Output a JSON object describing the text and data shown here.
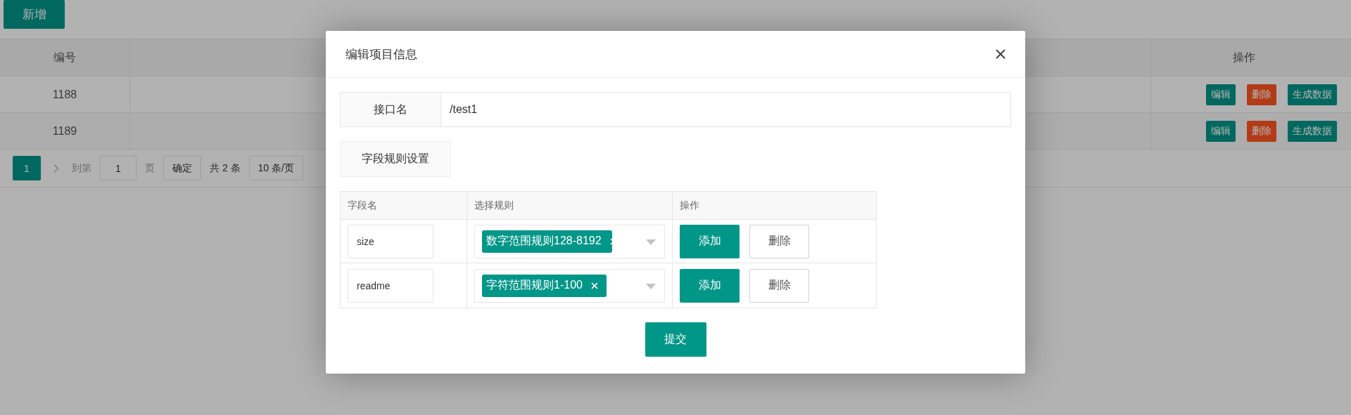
{
  "page": {
    "add_button": "新增",
    "table": {
      "columns": [
        {
          "label": "编号"
        },
        {
          "label": "操作"
        }
      ],
      "rows": [
        {
          "id": "1188",
          "actions": [
            {
              "label": "编辑",
              "kind": "primary"
            },
            {
              "label": "删除",
              "kind": "danger"
            },
            {
              "label": "生成数据",
              "kind": "primary"
            }
          ]
        },
        {
          "id": "1189",
          "actions": [
            {
              "label": "编辑",
              "kind": "primary"
            },
            {
              "label": "删除",
              "kind": "danger"
            },
            {
              "label": "生成数据",
              "kind": "primary"
            }
          ]
        }
      ]
    },
    "pagination": {
      "pages": [
        {
          "label": "1",
          "selected": true
        }
      ],
      "goto_label": "到第",
      "goto_value": "1",
      "page_unit": "页",
      "confirm": "确定",
      "total": "共 2 条",
      "page_size": "10 条/页"
    }
  },
  "dialog": {
    "title": "编辑项目信息",
    "interface": {
      "label": "接口名",
      "value": "/test1"
    },
    "section_button": "字段规则设置",
    "rules_table": {
      "columns": [
        "字段名",
        "选择规则",
        "操作"
      ],
      "rows": [
        {
          "field": "size",
          "rules": [
            {
              "label": "数字范围规则128-8192"
            }
          ],
          "add": "添加",
          "delete": "删除"
        },
        {
          "field": "readme",
          "rules": [
            {
              "label": "字符范围规则1-100"
            }
          ],
          "add": "添加",
          "delete": "删除"
        }
      ]
    },
    "submit": "提交"
  }
}
